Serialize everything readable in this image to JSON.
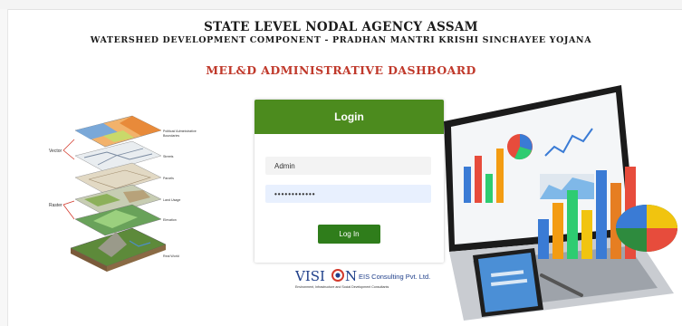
{
  "header": {
    "org": "STATE LEVEL NODAL AGENCY ASSAM",
    "subtitle": "WATERSHED DEVELOPMENT COMPONENT - PRADHAN MANTRI KRISHI SINCHAYEE YOJANA",
    "dashboard_title": "MEL&D ADMINISTRATIVE DASHBOARD"
  },
  "login": {
    "heading": "Login",
    "username_value": "Admin",
    "password_value": "••••••••••••",
    "button_label": "Log In"
  },
  "logo": {
    "name_part1": "VISI",
    "name_part2": "N",
    "company": "EIS Consulting Pvt. Ltd.",
    "tagline": "Environment, Infrastructure and Social Development Consultants",
    "brand_color": "#1f3f8a",
    "accent_color": "#d33a2c"
  },
  "colors": {
    "header_green": "#4c8b1e",
    "button_green": "#2f7d1b",
    "title_red": "#c0392b"
  },
  "illustrations": {
    "gis_layers": [
      "Political/ Administrative Boundaries",
      "Streets",
      "Parcels",
      "Land Usage",
      "Elevation",
      "Real World"
    ],
    "gis_side_labels": [
      "Vector",
      "Raster"
    ]
  }
}
